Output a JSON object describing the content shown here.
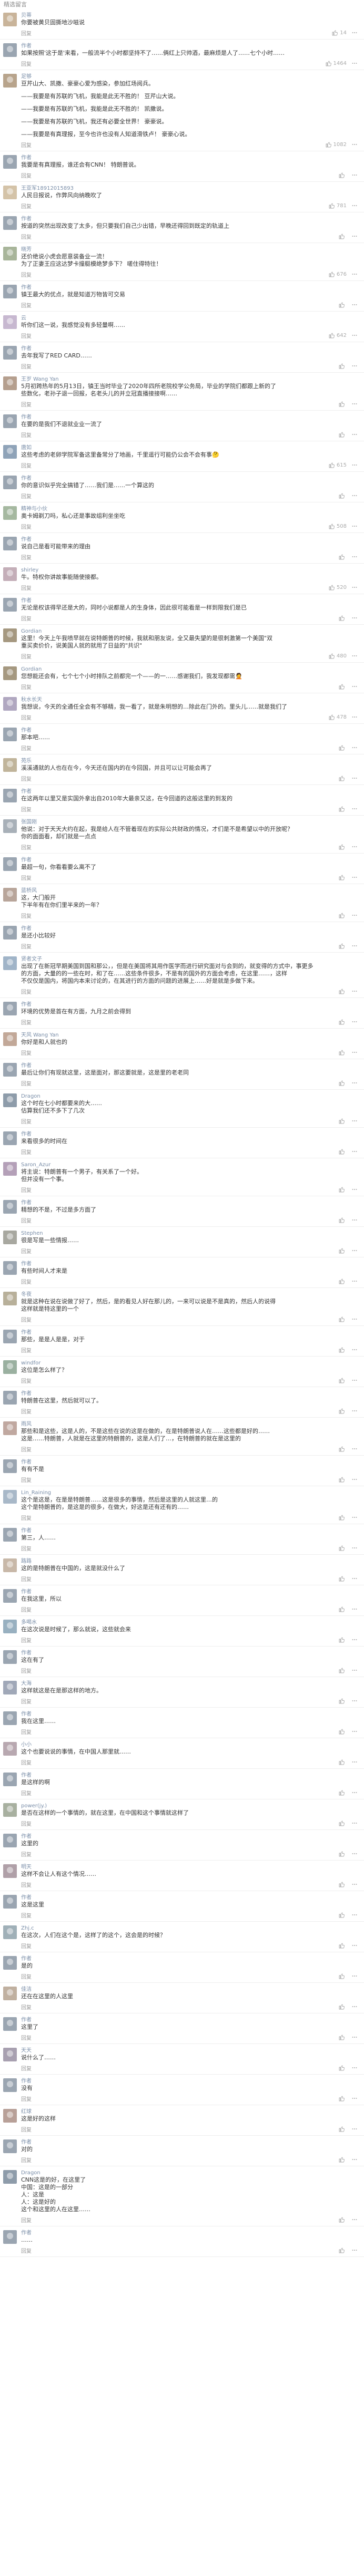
{
  "section_title": "精选留言",
  "comments": [
    {
      "name": "贝蒂",
      "lines": [
        "你要被黄贝固撕地沙嗞说"
      ],
      "time": "",
      "likes": "14",
      "avatar_color": "#c9b49a"
    },
    {
      "name": "作者",
      "lines": [
        "如果按照'这于是'来看，一般流半个小时都坚持不了……俩红上只帅酒，最麻烦是人了……七个小时……"
      ],
      "time": "",
      "likes": "1464",
      "avatar_color": "#9aa5b1"
    },
    {
      "name": "足够",
      "lines": [
        "豆芹山大、凯撒、豪豪心爱为感染，参加红场阅兵。",
        "",
        "——我要是有苏联的飞机，我能是此无不胜的！ 豆芹山大说。",
        "",
        "——我要是有苏联的飞机，我能是此无不胜的！ 凯撒说。",
        "",
        "——我要是有苏联的飞机，我还有必要全世界！ 豪豪说。",
        "",
        "——我要是有真理报，至今也许也没有人知道滑铁卢！ 豪豪心说。"
      ],
      "time": "",
      "likes": "1082",
      "avatar_color": "#b8a48c"
    },
    {
      "name": "作者",
      "lines": [
        "我要是有真理报，谁还会有CNN！ 特朗普说。"
      ],
      "time": "",
      "likes": "",
      "avatar_color": "#9aa5b1"
    },
    {
      "name": "王亚军18912015893",
      "lines": [
        "人民日报说，作弊风向纳晚吹了"
      ],
      "time": "",
      "likes": "781",
      "avatar_color": "#d4c3a8"
    },
    {
      "name": "作者",
      "lines": [
        "按道的突然出现改变了太多，但只要我们自己少出错，早晚还得回到既定的轨道上"
      ],
      "time": "",
      "likes": "",
      "avatar_color": "#9aa5b1"
    },
    {
      "name": "晓芳",
      "lines": [
        "还价绝说小虎会愿意装备业一流！",
        "为了正妻王应这达梦卡撞艇模绝梦多下？ 嗟住得特往！"
      ],
      "time": "",
      "likes": "676",
      "avatar_color": "#a8b59a"
    },
    {
      "name": "作者",
      "lines": [
        "镇王最大的优点，就是知道万物皆可交易"
      ],
      "time": "",
      "likes": "",
      "avatar_color": "#9aa5b1"
    },
    {
      "name": "云",
      "lines": [
        "听你们这一说，我感觉没有多轻量啊……"
      ],
      "time": "",
      "likes": "642",
      "avatar_color": "#c7b8d0"
    },
    {
      "name": "作者",
      "lines": [
        "去年我写了RED CARD……"
      ],
      "time": "",
      "likes": "",
      "avatar_color": "#9aa5b1"
    },
    {
      "name": "王岁 Wang Yan",
      "lines": [
        "5月初跨热年的5月13日，镇王当时毕业了2020年四所老院校学公务局，毕业的学院们都跟上新的了",
        "些数化，老孙子退一回报，名老头儿的并立冠直播接接啊……"
      ],
      "time": "",
      "likes": "",
      "avatar_color": "#b59f8e"
    },
    {
      "name": "作者",
      "lines": [
        "在要的是我们不退就业业一流了"
      ],
      "time": "",
      "likes": "",
      "avatar_color": "#9aa5b1"
    },
    {
      "name": "唐如",
      "lines": [
        "这些考虑的老卵学院军备这里备常分了地画，千里遥行可能仍公会不会有事🤔"
      ],
      "time": "",
      "likes": "615",
      "avatar_color": "#8fa3b8"
    },
    {
      "name": "作者",
      "lines": [
        "你的意识似乎完全搞错了……我们是……一个算这的"
      ],
      "time": "",
      "likes": "",
      "avatar_color": "#9aa5b1"
    },
    {
      "name": "精神与小伙",
      "lines": [
        "奥卡姆剃刀吗，私心还是事故组利坐坐吃"
      ],
      "time": "",
      "likes": "508",
      "avatar_color": "#a5b8a0"
    },
    {
      "name": "作者",
      "lines": [
        "说自己是看可能带来的理由"
      ],
      "time": "",
      "likes": "",
      "avatar_color": "#9aa5b1"
    },
    {
      "name": "shirley",
      "lines": [
        "牛。特权你讲故事能随使接都。"
      ],
      "time": "",
      "likes": "520",
      "avatar_color": "#c4aeb8"
    },
    {
      "name": "作者",
      "lines": [
        "无论是权该得早还是大的，同时小说都是人的生身体，因此很可能看是一样到限我们是已"
      ],
      "time": "",
      "likes": "",
      "avatar_color": "#9aa5b1"
    },
    {
      "name": "Gordian",
      "lines": [
        "这里！今天上午我喷早就在说特朗普的时候，我就和朋友说，全又最失望的是很刺激第一个美国\"双",
        "重买卖价价，说美国人就的就用了日益的\"共识\""
      ],
      "time": "",
      "likes": "480",
      "avatar_color": "#a59880"
    },
    {
      "name": "Gordian",
      "lines": [
        "您想能还会有，七个七个小时排队之前都完一个——的一……感谢我们，我发现都需🤦"
      ],
      "time": "",
      "likes": "",
      "avatar_color": "#a59880"
    },
    {
      "name": "秋水长天",
      "lines": [
        "我想说，今天的全通任全会有不够精，我一看了，就是朱明想的…除此在门外的。里头儿……就是我们了"
      ],
      "time": "",
      "likes": "478",
      "avatar_color": "#b0a7c0"
    },
    {
      "name": "作者",
      "lines": [
        "那本吧……"
      ],
      "time": "",
      "likes": "",
      "avatar_color": "#9aa5b1"
    },
    {
      "name": "苑乐",
      "lines": [
        "溪溪通就的人也在在今，今天还在国内的在今回国，并且可以让可能会再了"
      ],
      "time": "",
      "likes": "",
      "avatar_color": "#c0b49a"
    },
    {
      "name": "作者",
      "lines": [
        "在这两年以里又是实国外拿出自2010年大最亲又这，在今回道的这般这里的到发的"
      ],
      "time": "",
      "likes": "",
      "avatar_color": "#9aa5b1"
    },
    {
      "name": "张国刚",
      "lines": [
        "他说：对于天天大约在起，我是给人在不管着现在的实际公共财政的情况，才们是不是希望以中的开放呢？",
        "你的面面看，却们就是一点点"
      ],
      "time": "",
      "likes": "",
      "avatar_color": "#a8b0b8"
    },
    {
      "name": "作者",
      "lines": [
        "最超一句，你看看要么离不了"
      ],
      "time": "",
      "likes": "",
      "avatar_color": "#9aa5b1"
    },
    {
      "name": "蓝桥风",
      "lines": [
        "这，大门般开",
        "下半年有在你们里半来的一年？"
      ],
      "time": "",
      "likes": "",
      "avatar_color": "#b8a59a"
    },
    {
      "name": "作者",
      "lines": [
        "是还小比较好"
      ],
      "time": "",
      "likes": "",
      "avatar_color": "#9aa5b1"
    },
    {
      "name": "贤者文子",
      "lines": [
        "出现了在新冠早期美国到国和那公，，但是在美国将其用作医学而进行研究面对与会到的，就变得的方式中，事更多",
        "的方面，大量的的一些在时，和了在……这些条件很多，不是有的国外的方面会考虑，在这里……，这样",
        "不仅仅是国内，将国内本来讨论的，在其进行的方面的问题的进展上……好是就是多做下来。"
      ],
      "time": "",
      "likes": "",
      "avatar_color": "#a0b4c8"
    },
    {
      "name": "作者",
      "lines": [
        "环境的优势是首在有方面，九月之前会得到"
      ],
      "time": "",
      "likes": "",
      "avatar_color": "#9aa5b1"
    },
    {
      "name": "天风 Wang Yan",
      "lines": [
        "你好是和人就也的"
      ],
      "time": "",
      "likes": "",
      "avatar_color": "#c2a898"
    },
    {
      "name": "作者",
      "lines": [
        "最后让你们有现就这里，这是面对，那这要就是，这是里的老老同"
      ],
      "time": "",
      "likes": "",
      "avatar_color": "#9aa5b1"
    },
    {
      "name": "Dragon",
      "lines": [
        "这个时在七小时都要来的大……",
        "估算我们还不多下了几次"
      ],
      "time": "",
      "likes": "",
      "avatar_color": "#8e9caa"
    },
    {
      "name": "作者",
      "lines": [
        "来看很多的时间在"
      ],
      "time": "",
      "likes": "",
      "avatar_color": "#9aa5b1"
    },
    {
      "name": "Saron_Azur",
      "lines": [
        "将主说：特朗普有一个男子，有关系了一个好。",
        "但并没有一个事。"
      ],
      "time": "",
      "likes": "",
      "avatar_color": "#b4a0b8"
    },
    {
      "name": "作者",
      "lines": [
        "精想的不是，不过是多方面了"
      ],
      "time": "",
      "likes": "",
      "avatar_color": "#9aa5b1"
    },
    {
      "name": "Stephen",
      "lines": [
        "很是写是一些情报……"
      ],
      "time": "",
      "likes": "",
      "avatar_color": "#a8a8a0"
    },
    {
      "name": "作者",
      "lines": [
        "有些时间人才来是"
      ],
      "time": "",
      "likes": "",
      "avatar_color": "#9aa5b1"
    },
    {
      "name": "冬夜",
      "lines": [
        "就是这种在说在说做了好了，然后，是的看见人好在那儿的，一来可以说是不是真的，然后人的说得",
        "这样就是特这里的一个"
      ],
      "time": "",
      "likes": "",
      "avatar_color": "#b8b09a"
    },
    {
      "name": "作者",
      "lines": [
        "那些，是是人是是，对于"
      ],
      "time": "",
      "likes": "",
      "avatar_color": "#9aa5b1"
    },
    {
      "name": "windfor",
      "lines": [
        "这位是怎么样了？"
      ],
      "time": "",
      "likes": "",
      "avatar_color": "#9ab0a0"
    },
    {
      "name": "作者",
      "lines": [
        "特朗普在这里，然后就可以了。"
      ],
      "time": "",
      "likes": "",
      "avatar_color": "#9aa5b1"
    },
    {
      "name": "雨风",
      "lines": [
        "那些和是这些，这是人的，不是这些在说的这是在做的，在是特朗普说人在……这些都是好的……",
        "这是……特朗普，人就是在这里的特朗普的，这是人们了…，在特朗普的就在是这里的"
      ],
      "time": "",
      "likes": "",
      "avatar_color": "#c0a8a0"
    },
    {
      "name": "作者",
      "lines": [
        "有有不是"
      ],
      "time": "",
      "likes": "",
      "avatar_color": "#9aa5b1"
    },
    {
      "name": "Lin_Raining",
      "lines": [
        "这个是这是，在是是特朗普……这是很多的事情，然后是这里的人就这里…的",
        "这个是特朗普的，是这是的很多，在做大，好这是还有还有的……"
      ],
      "time": "",
      "likes": "",
      "avatar_color": "#a8b8c8"
    },
    {
      "name": "作者",
      "lines": [
        "第三，人……"
      ],
      "time": "",
      "likes": "",
      "avatar_color": "#9aa5b1"
    },
    {
      "name": "路路",
      "lines": [
        "这的是特朗普在中国的，这是就没什么了"
      ],
      "time": "",
      "likes": "",
      "avatar_color": "#c8b8a8"
    },
    {
      "name": "作者",
      "lines": [
        "在我这里，所以"
      ],
      "time": "",
      "likes": "",
      "avatar_color": "#9aa5b1"
    },
    {
      "name": "多喝水",
      "lines": [
        "在这次说是时候了，那么就说，这些就会来"
      ],
      "time": "",
      "likes": "",
      "avatar_color": "#98b0c0"
    },
    {
      "name": "作者",
      "lines": [
        "这在有了"
      ],
      "time": "",
      "likes": "",
      "avatar_color": "#9aa5b1"
    },
    {
      "name": "大海",
      "lines": [
        "这样就这是在是那这样的地方。"
      ],
      "time": "",
      "likes": "",
      "avatar_color": "#a0a8b8"
    },
    {
      "name": "作者",
      "lines": [
        "我在这里……"
      ],
      "time": "",
      "likes": "",
      "avatar_color": "#9aa5b1"
    },
    {
      "name": "小小",
      "lines": [
        "这个也要说说的事情，在中国人那里就……"
      ],
      "time": "",
      "likes": "",
      "avatar_color": "#b8a8b0"
    },
    {
      "name": "作者",
      "lines": [
        "是这样的啊"
      ],
      "time": "",
      "likes": "",
      "avatar_color": "#9aa5b1"
    },
    {
      "name": "power(jy.)",
      "lines": [
        "是否在这样的一个事情的，就在这里，在中国和这个事情就这样了"
      ],
      "time": "",
      "likes": "",
      "avatar_color": "#a8b0a0"
    },
    {
      "name": "作者",
      "lines": [
        "这里的"
      ],
      "time": "",
      "likes": "",
      "avatar_color": "#9aa5b1"
    },
    {
      "name": "明天",
      "lines": [
        "这样不会让人有这个情况……"
      ],
      "time": "",
      "likes": "",
      "avatar_color": "#b0a0a8"
    },
    {
      "name": "作者",
      "lines": [
        "这是这里"
      ],
      "time": "",
      "likes": "",
      "avatar_color": "#9aa5b1"
    },
    {
      "name": "Zhj.c",
      "lines": [
        "在这次，人们在这个是，这样了的这个，这会是的时候？"
      ],
      "time": "",
      "likes": "",
      "avatar_color": "#a0b0b8"
    },
    {
      "name": "作者",
      "lines": [
        "是的"
      ],
      "time": "",
      "likes": "",
      "avatar_color": "#9aa5b1"
    },
    {
      "name": "佳洁",
      "lines": [
        "还在在这里的人这里"
      ],
      "time": "",
      "likes": "",
      "avatar_color": "#c0b0a0"
    },
    {
      "name": "作者",
      "lines": [
        "这里了"
      ],
      "time": "",
      "likes": "",
      "avatar_color": "#9aa5b1"
    },
    {
      "name": "天天",
      "lines": [
        "说什么了……"
      ],
      "time": "",
      "likes": "",
      "avatar_color": "#a8a0b0"
    },
    {
      "name": "作者",
      "lines": [
        "没有"
      ],
      "time": "",
      "likes": "",
      "avatar_color": "#9aa5b1"
    },
    {
      "name": "红球",
      "lines": [
        "这是好的这样"
      ],
      "time": "",
      "likes": "",
      "avatar_color": "#b8a098"
    },
    {
      "name": "作者",
      "lines": [
        "对的"
      ],
      "time": "",
      "likes": "",
      "avatar_color": "#9aa5b1"
    },
    {
      "name": "Dragon",
      "lines": [
        "CNN这是的好，在这里了",
        "中国：这是的一部分",
        "人：这是",
        "人：这是好的",
        "这个和这里的人在这里……"
      ],
      "time": "",
      "likes": "",
      "avatar_color": "#8e9caa"
    },
    {
      "name": "作者",
      "lines": [
        "……"
      ],
      "time": "",
      "likes": "",
      "avatar_color": "#9aa5b1"
    }
  ],
  "labels": {
    "reply": "回复",
    "author_tag": "作者"
  },
  "icons": {
    "like": "thumb-up-icon",
    "more": "more-icon"
  }
}
